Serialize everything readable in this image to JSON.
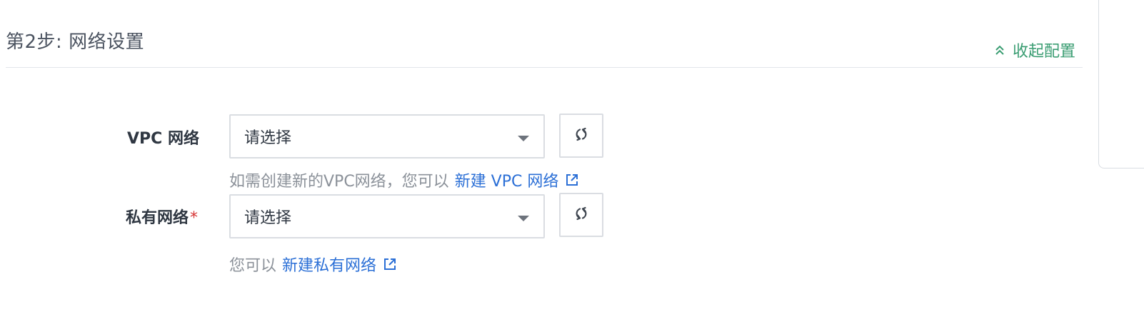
{
  "section": {
    "step_title": "第2步: 网络设置",
    "collapse_label": "收起配置"
  },
  "form": {
    "vpc": {
      "label": "VPC 网络",
      "selected": "请选择",
      "help_prefix": "如需创建新的VPC网络，您可以",
      "help_link": "新建 VPC 网络"
    },
    "subnet": {
      "label": "私有网络",
      "required_mark": "*",
      "selected": "请选择",
      "help_prefix": "您可以",
      "help_link": "新建私有网络"
    }
  },
  "icons": {
    "collapse": "double-chevron-up-icon",
    "caret": "caret-down-icon",
    "refresh": "refresh-icon",
    "external_link": "external-link-icon"
  },
  "colors": {
    "accent_green": "#3a9d72",
    "link_blue": "#2b6fd6",
    "required_red": "#d63434",
    "muted_text": "#8b9199"
  }
}
